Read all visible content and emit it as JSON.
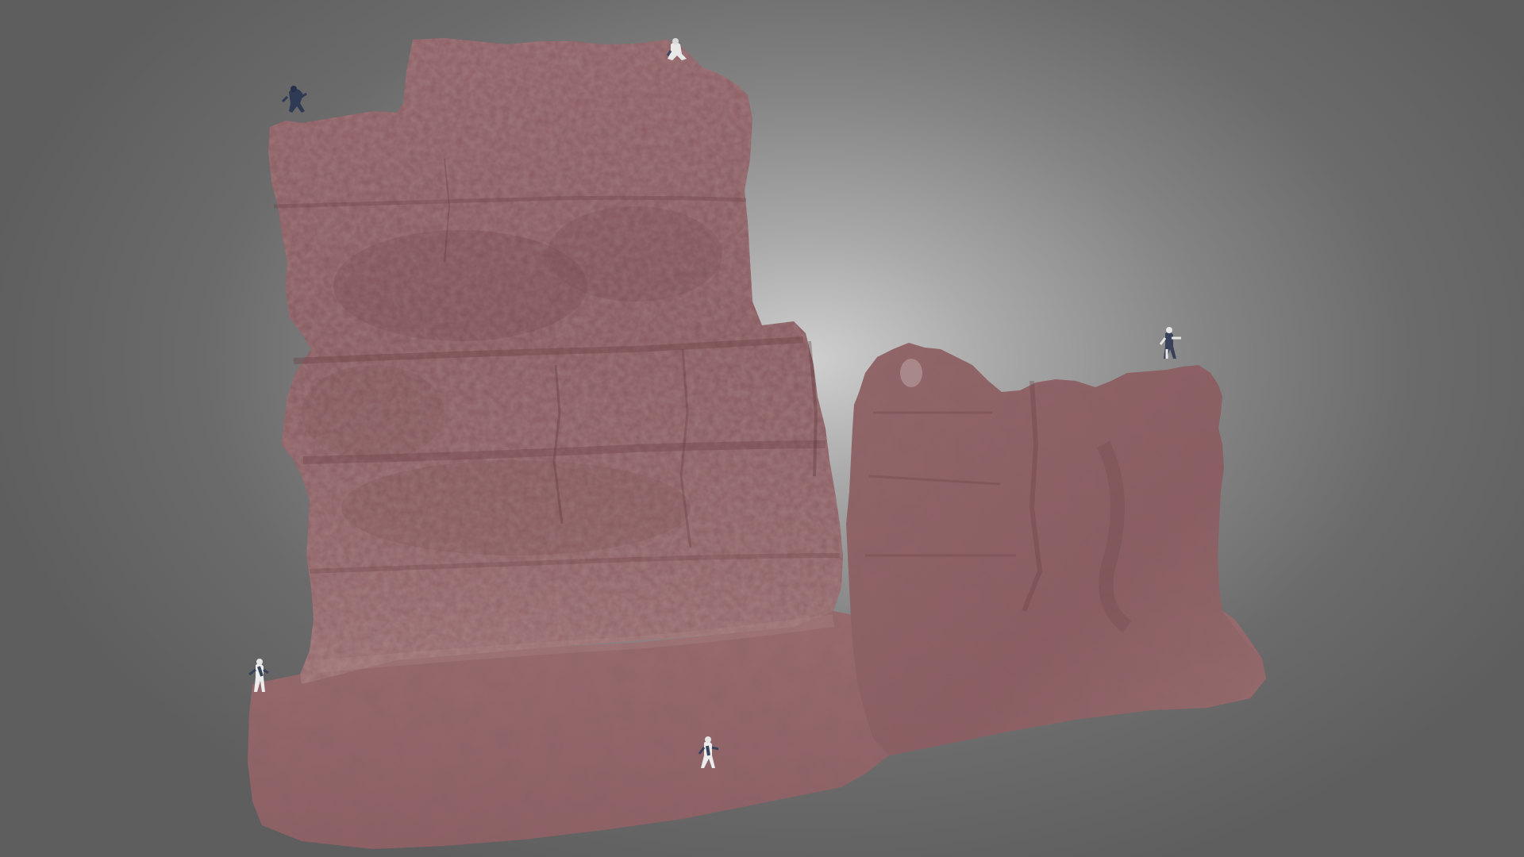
{
  "scene": {
    "model": "red-rock-cliff-photogrammetry",
    "rock_color": "#8a5a5e",
    "rock_shadow_color": "#6e4347",
    "rock_highlight_color": "#a5787a",
    "background_center": "#cfcfcf",
    "background_edge": "#5e5e5e",
    "figures": [
      {
        "name": "climber-figure-top-left",
        "pose": "crouching"
      },
      {
        "name": "climber-figure-top-center",
        "pose": "sitting"
      },
      {
        "name": "climber-figure-right-ledge",
        "pose": "walking"
      },
      {
        "name": "climber-figure-bottom-left",
        "pose": "walking"
      },
      {
        "name": "climber-figure-bottom-center",
        "pose": "walking"
      }
    ]
  }
}
